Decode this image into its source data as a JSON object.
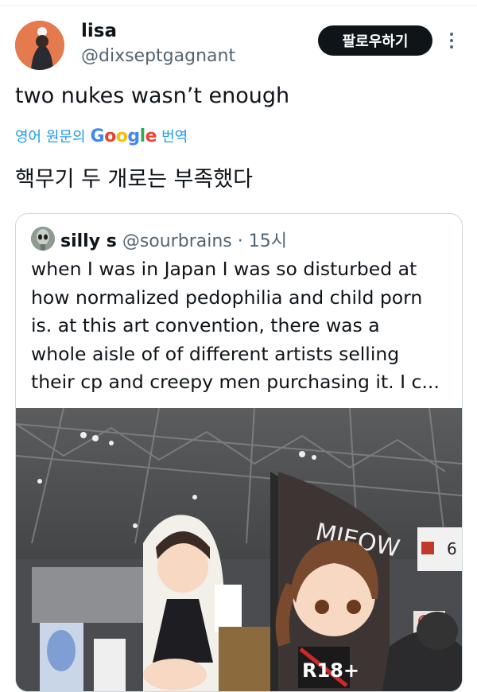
{
  "author": {
    "name": "lisa",
    "handle": "@dixseptgagnant",
    "follow_label": "팔로우하기"
  },
  "tweet": {
    "text": "two nukes wasn’t enough",
    "translate_prefix": "영어 원문의",
    "translate_brand": "Google",
    "translate_suffix": "번역",
    "translated_text": "핵무기 두 개로는 부족했다"
  },
  "quoted_tweet": {
    "name": "silly s",
    "handle": "@sourbrains",
    "separator": "·",
    "time": "15시",
    "text_lines": [
      "when I was in Japan I was so disturbed at",
      "how normalized pedophilia and child porn",
      "is. at this art convention, there was a",
      "whole aisle of of different artists selling",
      "their cp and creepy men purchasing it. I c..."
    ],
    "image": {
      "banner_text": "MIEOW",
      "rating_text": "R18+",
      "hall_sign": "東 6"
    }
  },
  "colors": {
    "accent": "#1d9bf0",
    "text": "#0f1419",
    "muted": "#536471",
    "border": "#cfd9de",
    "follow_bg": "#0f1419"
  }
}
